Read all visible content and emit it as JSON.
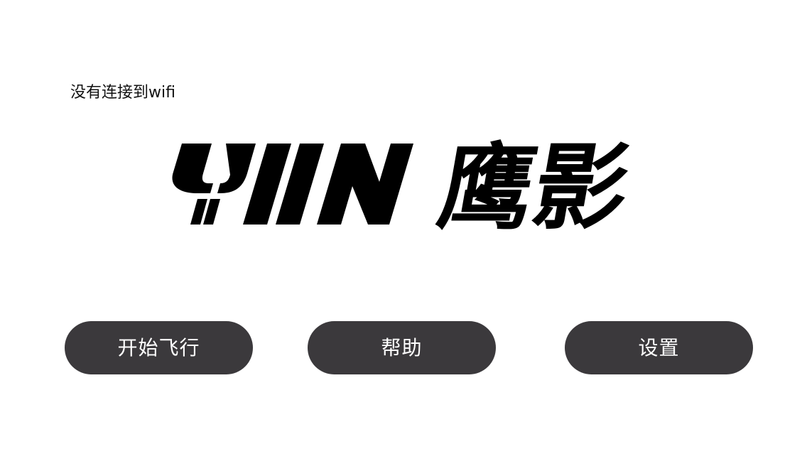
{
  "status": {
    "wifi_text": "没有连接到wifi"
  },
  "logo": {
    "text": "YIN鹰影",
    "latin": "YIN",
    "cjk": "鹰影",
    "color": "#000000"
  },
  "menu": {
    "start_label": "开始飞行",
    "help_label": "帮助",
    "settings_label": "设置",
    "button_color": "#3b393c",
    "button_text_color": "#ffffff"
  }
}
